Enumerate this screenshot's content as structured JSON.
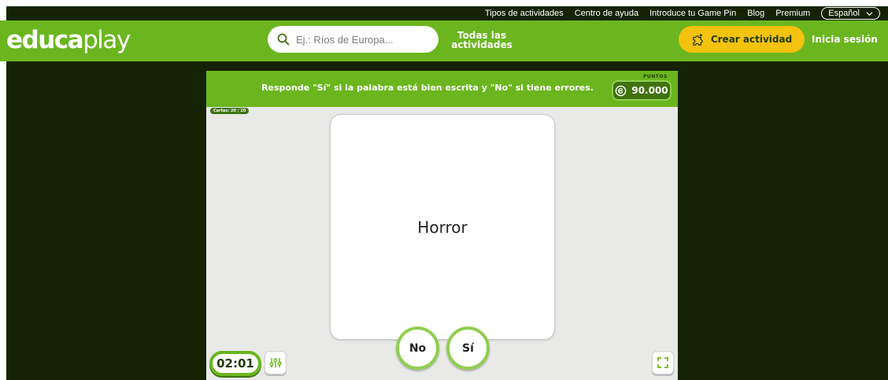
{
  "colors": {
    "brand_green": "#6bb61f",
    "dark_green": "#142303",
    "accent_yellow": "#f5c20d",
    "points_green": "#3f7310"
  },
  "topbar": {
    "links": [
      {
        "label": "Tipos de actividades"
      },
      {
        "label": "Centro de ayuda"
      },
      {
        "label": "Introduce tu Game Pin"
      },
      {
        "label": "Blog"
      },
      {
        "label": "Premium"
      }
    ],
    "language": {
      "selected": "Español",
      "icon": "chevron-down-icon"
    }
  },
  "header": {
    "logo": {
      "bold": "educa",
      "light": "play"
    },
    "search": {
      "placeholder": "Ej.: Ríos de Europa...",
      "value": "",
      "icon": "search-icon"
    },
    "all_activities": "Todas las actividades",
    "create_button": {
      "label": "Crear actividad",
      "icon": "puzzle-icon"
    },
    "login": "Inicia sesión"
  },
  "game": {
    "instruction": "Responde \"Sí\" si la palabra está bien escrita y \"No\" si tiene errores.",
    "points_label": "PUNTOS",
    "points_value": "90.000",
    "cards_counter": "Cartas: 20 / 20",
    "card_word": "Horror",
    "no_button": "No",
    "yes_button": "Sí",
    "timer": "02:01",
    "settings_icon": "sliders-icon",
    "fullscreen_icon": "fullscreen-icon"
  }
}
